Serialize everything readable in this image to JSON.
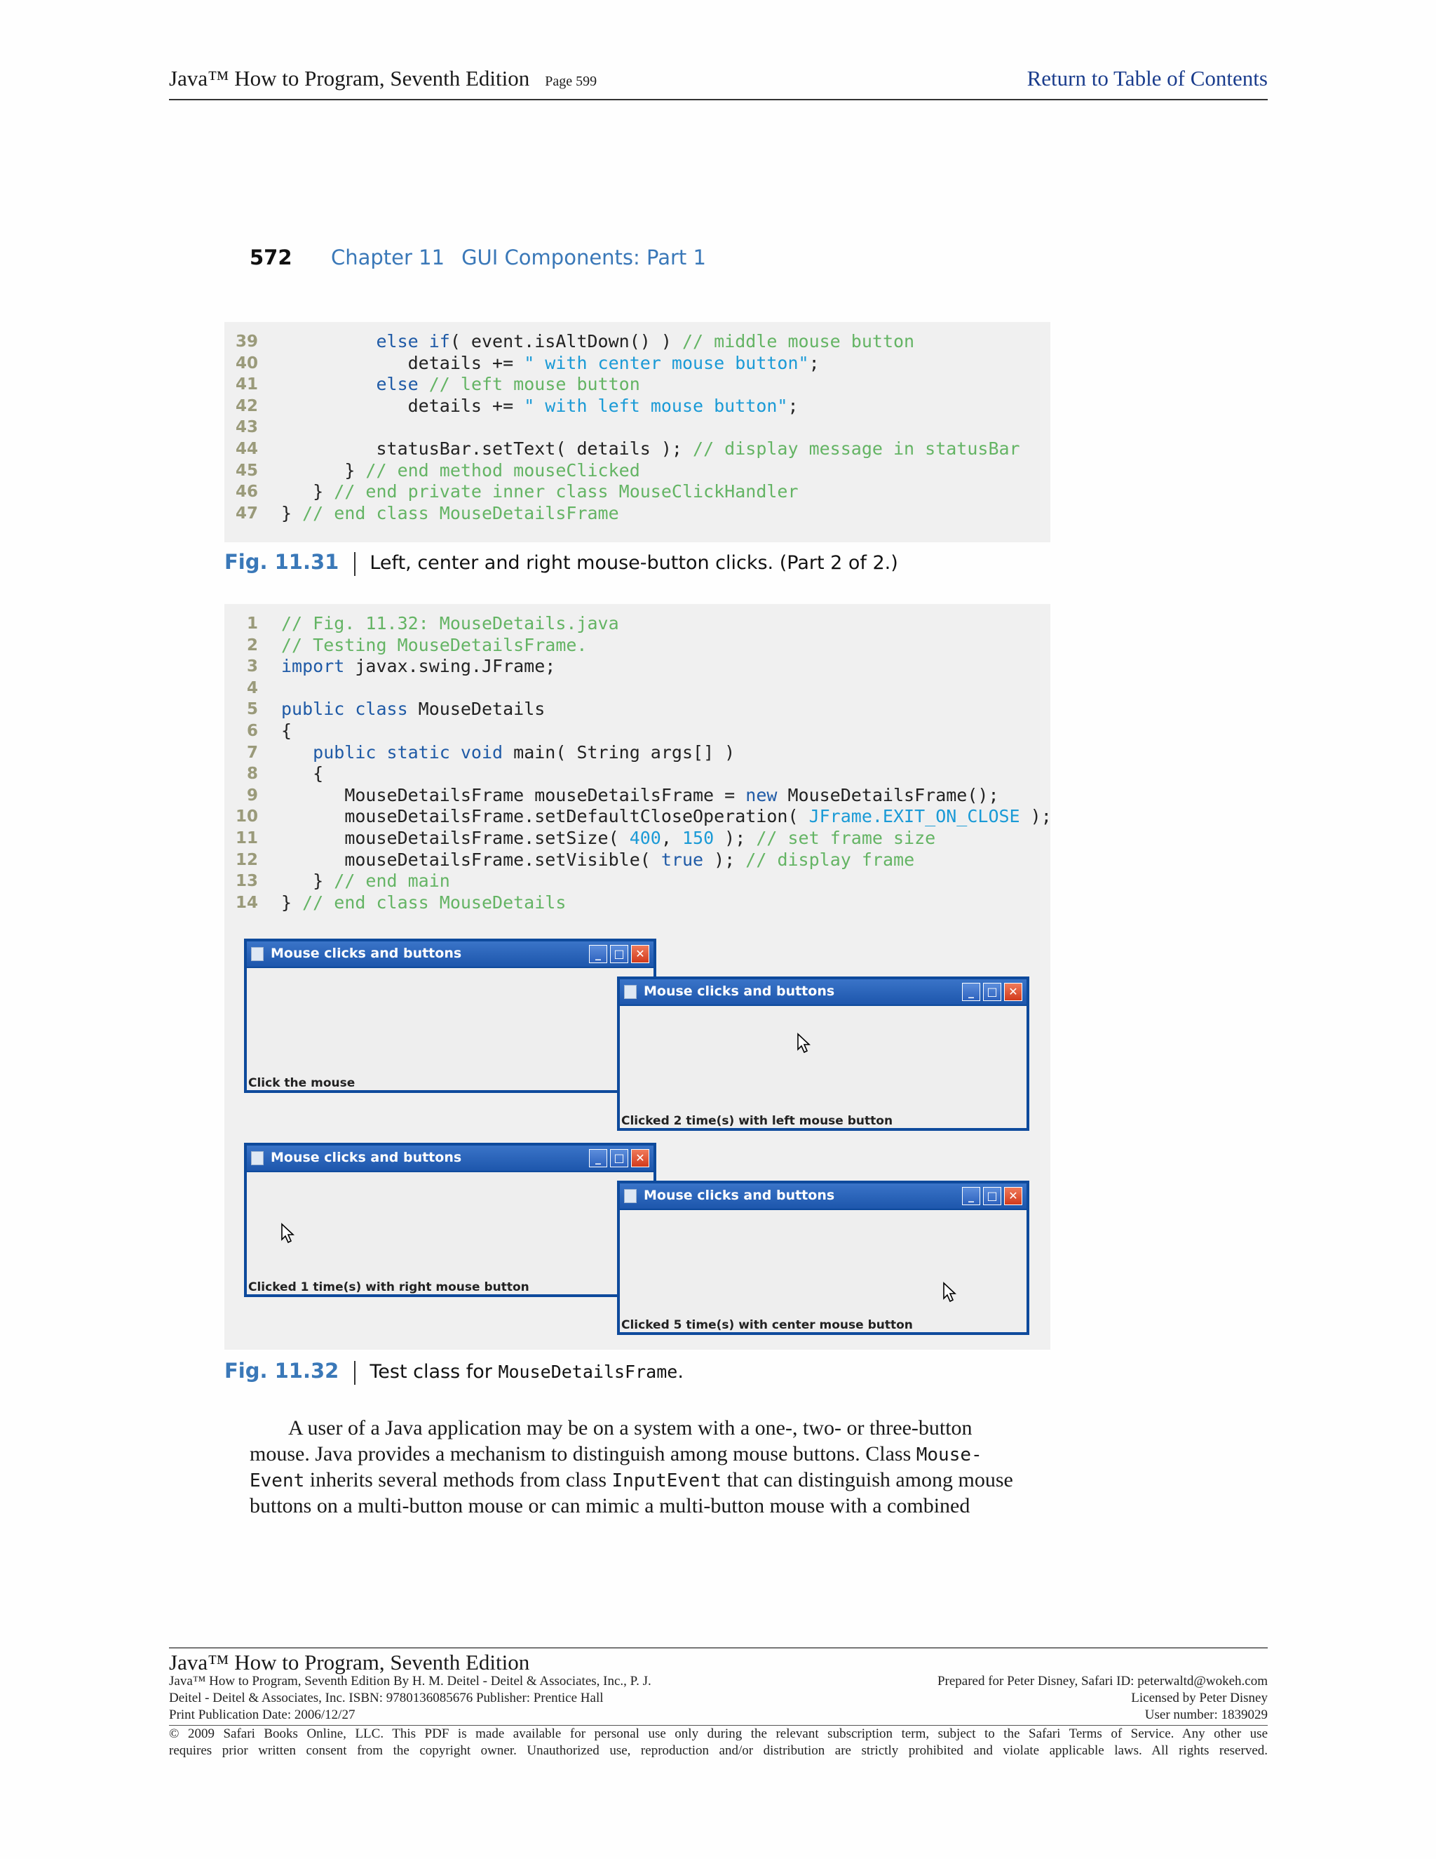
{
  "header": {
    "book_title": "Java™ How to Program, Seventh Edition",
    "page": "Page 599",
    "toc_link": "Return to Table of Contents"
  },
  "running_head": {
    "page_number": "572",
    "chapter": "Chapter 11",
    "chapter_title": "GUI Components: Part 1"
  },
  "fig_11_31": {
    "lines": [
      {
        "n": "39",
        "indent": "         ",
        "tokens": [
          [
            "kw",
            "else if"
          ],
          [
            "",
            "( event.isAltDown() ) "
          ],
          [
            "cm",
            "// middle mouse button"
          ]
        ]
      },
      {
        "n": "40",
        "indent": "            ",
        "tokens": [
          [
            "",
            "details += "
          ],
          [
            "st",
            "\" with center mouse button\""
          ],
          [
            "",
            ";"
          ]
        ]
      },
      {
        "n": "41",
        "indent": "         ",
        "tokens": [
          [
            "kw",
            "else"
          ],
          [
            "",
            " "
          ],
          [
            "cm",
            "// left mouse button"
          ]
        ]
      },
      {
        "n": "42",
        "indent": "            ",
        "tokens": [
          [
            "",
            "details += "
          ],
          [
            "st",
            "\" with left mouse button\""
          ],
          [
            "",
            ";"
          ]
        ]
      },
      {
        "n": "43",
        "indent": "",
        "tokens": []
      },
      {
        "n": "44",
        "indent": "         ",
        "tokens": [
          [
            "",
            "statusBar.setText( details ); "
          ],
          [
            "cm",
            "// display message in statusBar"
          ]
        ]
      },
      {
        "n": "45",
        "indent": "      ",
        "tokens": [
          [
            "",
            "} "
          ],
          [
            "cm",
            "// end method mouseClicked"
          ]
        ]
      },
      {
        "n": "46",
        "indent": "   ",
        "tokens": [
          [
            "",
            "} "
          ],
          [
            "cm",
            "// end private inner class MouseClickHandler"
          ]
        ]
      },
      {
        "n": "47",
        "indent": "",
        "tokens": [
          [
            "",
            "} "
          ],
          [
            "cm",
            "// end class MouseDetailsFrame"
          ]
        ]
      }
    ],
    "caption_label": "Fig. 11.31",
    "caption_text": "Left, center and right mouse-button clicks. (Part 2 of 2.)"
  },
  "fig_11_32": {
    "lines": [
      {
        "n": "1",
        "indent": "",
        "tokens": [
          [
            "cm",
            "// Fig. 11.32: MouseDetails.java"
          ]
        ]
      },
      {
        "n": "2",
        "indent": "",
        "tokens": [
          [
            "cm",
            "// Testing MouseDetailsFrame."
          ]
        ]
      },
      {
        "n": "3",
        "indent": "",
        "tokens": [
          [
            "kw",
            "import"
          ],
          [
            "",
            " javax.swing.JFrame;"
          ]
        ]
      },
      {
        "n": "4",
        "indent": "",
        "tokens": []
      },
      {
        "n": "5",
        "indent": "",
        "tokens": [
          [
            "kw",
            "public class"
          ],
          [
            "",
            " MouseDetails"
          ]
        ]
      },
      {
        "n": "6",
        "indent": "",
        "tokens": [
          [
            "",
            "{"
          ]
        ]
      },
      {
        "n": "7",
        "indent": "   ",
        "tokens": [
          [
            "kw",
            "public static void"
          ],
          [
            "",
            " main( String args[] )"
          ]
        ]
      },
      {
        "n": "8",
        "indent": "   ",
        "tokens": [
          [
            "",
            "{"
          ]
        ]
      },
      {
        "n": "9",
        "indent": "      ",
        "tokens": [
          [
            "",
            "MouseDetailsFrame mouseDetailsFrame = "
          ],
          [
            "kw",
            "new"
          ],
          [
            "",
            " MouseDetailsFrame();"
          ]
        ]
      },
      {
        "n": "10",
        "indent": "      ",
        "tokens": [
          [
            "",
            "mouseDetailsFrame.setDefaultCloseOperation( "
          ],
          [
            "st",
            "JFrame.EXIT_ON_CLOSE"
          ],
          [
            "",
            " );"
          ]
        ]
      },
      {
        "n": "11",
        "indent": "      ",
        "tokens": [
          [
            "",
            "mouseDetailsFrame.setSize( "
          ],
          [
            "st",
            "400"
          ],
          [
            "",
            ", "
          ],
          [
            "st",
            "150"
          ],
          [
            "",
            " ); "
          ],
          [
            "cm",
            "// set frame size"
          ]
        ]
      },
      {
        "n": "12",
        "indent": "      ",
        "tokens": [
          [
            "",
            "mouseDetailsFrame.setVisible( "
          ],
          [
            "kw",
            "true"
          ],
          [
            "",
            " ); "
          ],
          [
            "cm",
            "// display frame"
          ]
        ]
      },
      {
        "n": "13",
        "indent": "   ",
        "tokens": [
          [
            "",
            "} "
          ],
          [
            "cm",
            "// end main"
          ]
        ]
      },
      {
        "n": "14",
        "indent": "",
        "tokens": [
          [
            "",
            "} "
          ],
          [
            "cm",
            "// end class MouseDetails"
          ]
        ]
      }
    ],
    "caption_label": "Fig. 11.32",
    "caption_text": "Test class for ",
    "caption_code": "MouseDetailsFrame",
    "caption_end": "."
  },
  "windows": [
    {
      "title": "Mouse clicks and buttons",
      "status": "Click the mouse",
      "cursor": false
    },
    {
      "title": "Mouse clicks and buttons",
      "status": "Clicked 2 time(s) with left mouse button",
      "cursor": true
    },
    {
      "title": "Mouse clicks and buttons",
      "status": "Clicked 1 time(s) with right mouse button",
      "cursor": true
    },
    {
      "title": "Mouse clicks and buttons",
      "status": "Clicked 5 time(s) with center mouse button",
      "cursor": true
    }
  ],
  "window_buttons": {
    "minimize": "_",
    "maximize": "□",
    "close": "✕"
  },
  "paragraph": {
    "l1": "A user of a Java application may be on a system with a one-, two- or three-button",
    "l2a": "mouse. Java provides a mechanism to distinguish among mouse buttons. Class ",
    "l2b": "Mouse-",
    "l3a": "Event",
    "l3b": " inherits several methods from class ",
    "l3c": "InputEvent",
    "l3d": " that can distinguish among mouse",
    "l4": "buttons on a multi-button mouse or can mimic a multi-button mouse with a combined"
  },
  "footer": {
    "book_title": "Java™ How to Program, Seventh Edition",
    "left1": "Java™ How to Program, Seventh Edition By H. M. Deitel - Deitel & Associates, Inc., P. J.",
    "left2": "Deitel - Deitel & Associates, Inc. ISBN: 9780136085676 Publisher: Prentice Hall",
    "left3": "Print Publication Date: 2006/12/27",
    "right1": "Prepared for Peter Disney, Safari ID: peterwaltd@wokeh.com",
    "right2": "Licensed by Peter Disney",
    "right3": "User number: 1839029",
    "copy1": "© 2009 Safari Books Online, LLC. This PDF is made available for personal use only during the relevant subscription term, subject to the Safari Terms of Service. Any other use",
    "copy2": "requires prior written consent from the copyright owner. Unauthorized use, reproduction and/or distribution are strictly prohibited and violate applicable laws. All rights reserved."
  }
}
